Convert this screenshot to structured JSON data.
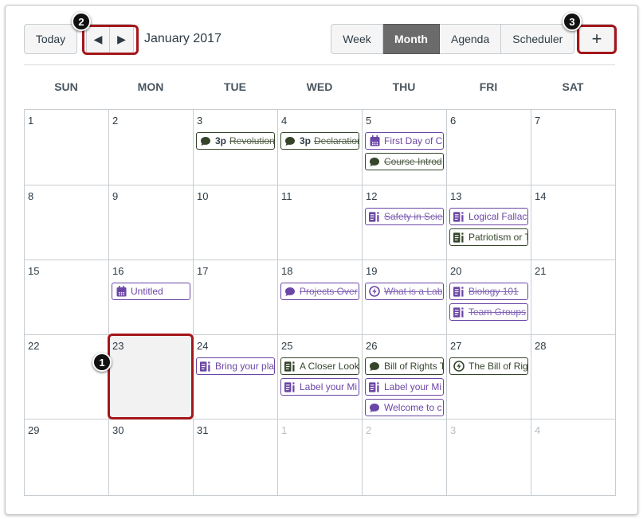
{
  "toolbar": {
    "today": "Today",
    "title": "January 2017",
    "views": [
      "Week",
      "Month",
      "Agenda",
      "Scheduler"
    ],
    "active_view": "Month",
    "add": "+",
    "prev_icon": "triangle-left",
    "next_icon": "triangle-right"
  },
  "weekdays": [
    "SUN",
    "MON",
    "TUE",
    "WED",
    "THU",
    "FRI",
    "SAT"
  ],
  "colors": {
    "purple": "#6b46a6",
    "green": "#34452a",
    "highlight": "#a4161a",
    "today_bg": "#f2f2f2"
  },
  "weeks": [
    [
      {
        "n": "1",
        "e": []
      },
      {
        "n": "2",
        "e": []
      },
      {
        "n": "3",
        "e": [
          {
            "i": "discussion",
            "c": "green",
            "time": "3p",
            "l": "Revolution",
            "d": true
          }
        ]
      },
      {
        "n": "4",
        "e": [
          {
            "i": "discussion",
            "c": "green",
            "time": "3p",
            "l": "Declaration",
            "d": true
          }
        ]
      },
      {
        "n": "5",
        "e": [
          {
            "i": "calendar",
            "c": "purple",
            "l": "First Day of C",
            "d": false
          },
          {
            "i": "discussion",
            "c": "green",
            "l": "Course Introd",
            "d": true
          }
        ]
      },
      {
        "n": "6",
        "e": []
      },
      {
        "n": "7",
        "e": []
      }
    ],
    [
      {
        "n": "8",
        "e": []
      },
      {
        "n": "9",
        "e": []
      },
      {
        "n": "10",
        "e": []
      },
      {
        "n": "11",
        "e": []
      },
      {
        "n": "12",
        "e": [
          {
            "i": "assignment",
            "c": "purple",
            "l": "Safety in Scien",
            "d": true
          }
        ]
      },
      {
        "n": "13",
        "e": [
          {
            "i": "assignment",
            "c": "purple",
            "l": "Logical Fallacy",
            "d": false
          },
          {
            "i": "assignment",
            "c": "green",
            "l": "Patriotism or T",
            "d": false
          }
        ]
      },
      {
        "n": "14",
        "e": []
      }
    ],
    [
      {
        "n": "15",
        "e": []
      },
      {
        "n": "16",
        "e": [
          {
            "i": "calendar",
            "c": "purple",
            "l": "Untitled",
            "d": false
          }
        ]
      },
      {
        "n": "17",
        "e": []
      },
      {
        "n": "18",
        "e": [
          {
            "i": "discussion",
            "c": "purple",
            "l": "Projects Over",
            "d": true
          }
        ]
      },
      {
        "n": "19",
        "e": [
          {
            "i": "quiz",
            "c": "purple",
            "l": "What is a Lab",
            "d": true
          }
        ]
      },
      {
        "n": "20",
        "e": [
          {
            "i": "assignment",
            "c": "purple",
            "l": "Biology 101",
            "d": true
          },
          {
            "i": "assignment",
            "c": "purple",
            "l": "Team Groups",
            "d": true
          }
        ]
      },
      {
        "n": "21",
        "e": []
      }
    ],
    [
      {
        "n": "22",
        "e": []
      },
      {
        "n": "23",
        "e": [],
        "today": true
      },
      {
        "n": "24",
        "e": [
          {
            "i": "assignment",
            "c": "purple",
            "l": "Bring your pla",
            "d": false
          }
        ]
      },
      {
        "n": "25",
        "e": [
          {
            "i": "assignment",
            "c": "green",
            "l": "A Closer Look",
            "d": false
          },
          {
            "i": "assignment",
            "c": "purple",
            "l": "Label your Mi",
            "d": false
          }
        ]
      },
      {
        "n": "26",
        "e": [
          {
            "i": "discussion",
            "c": "green",
            "l": "Bill of Rights T",
            "d": false
          },
          {
            "i": "assignment",
            "c": "purple",
            "l": "Label your Mi",
            "d": false
          },
          {
            "i": "discussion",
            "c": "purple",
            "l": "Welcome to c",
            "d": false
          }
        ]
      },
      {
        "n": "27",
        "e": [
          {
            "i": "quiz",
            "c": "green",
            "l": "The Bill of Rig",
            "d": false
          }
        ]
      },
      {
        "n": "28",
        "e": []
      }
    ],
    [
      {
        "n": "29",
        "e": []
      },
      {
        "n": "30",
        "e": []
      },
      {
        "n": "31",
        "e": []
      },
      {
        "n": "1",
        "e": [],
        "other": true
      },
      {
        "n": "2",
        "e": [],
        "other": true
      },
      {
        "n": "3",
        "e": [],
        "other": true
      },
      {
        "n": "4",
        "e": [],
        "other": true
      }
    ]
  ],
  "annotations": [
    "1",
    "2",
    "3"
  ]
}
